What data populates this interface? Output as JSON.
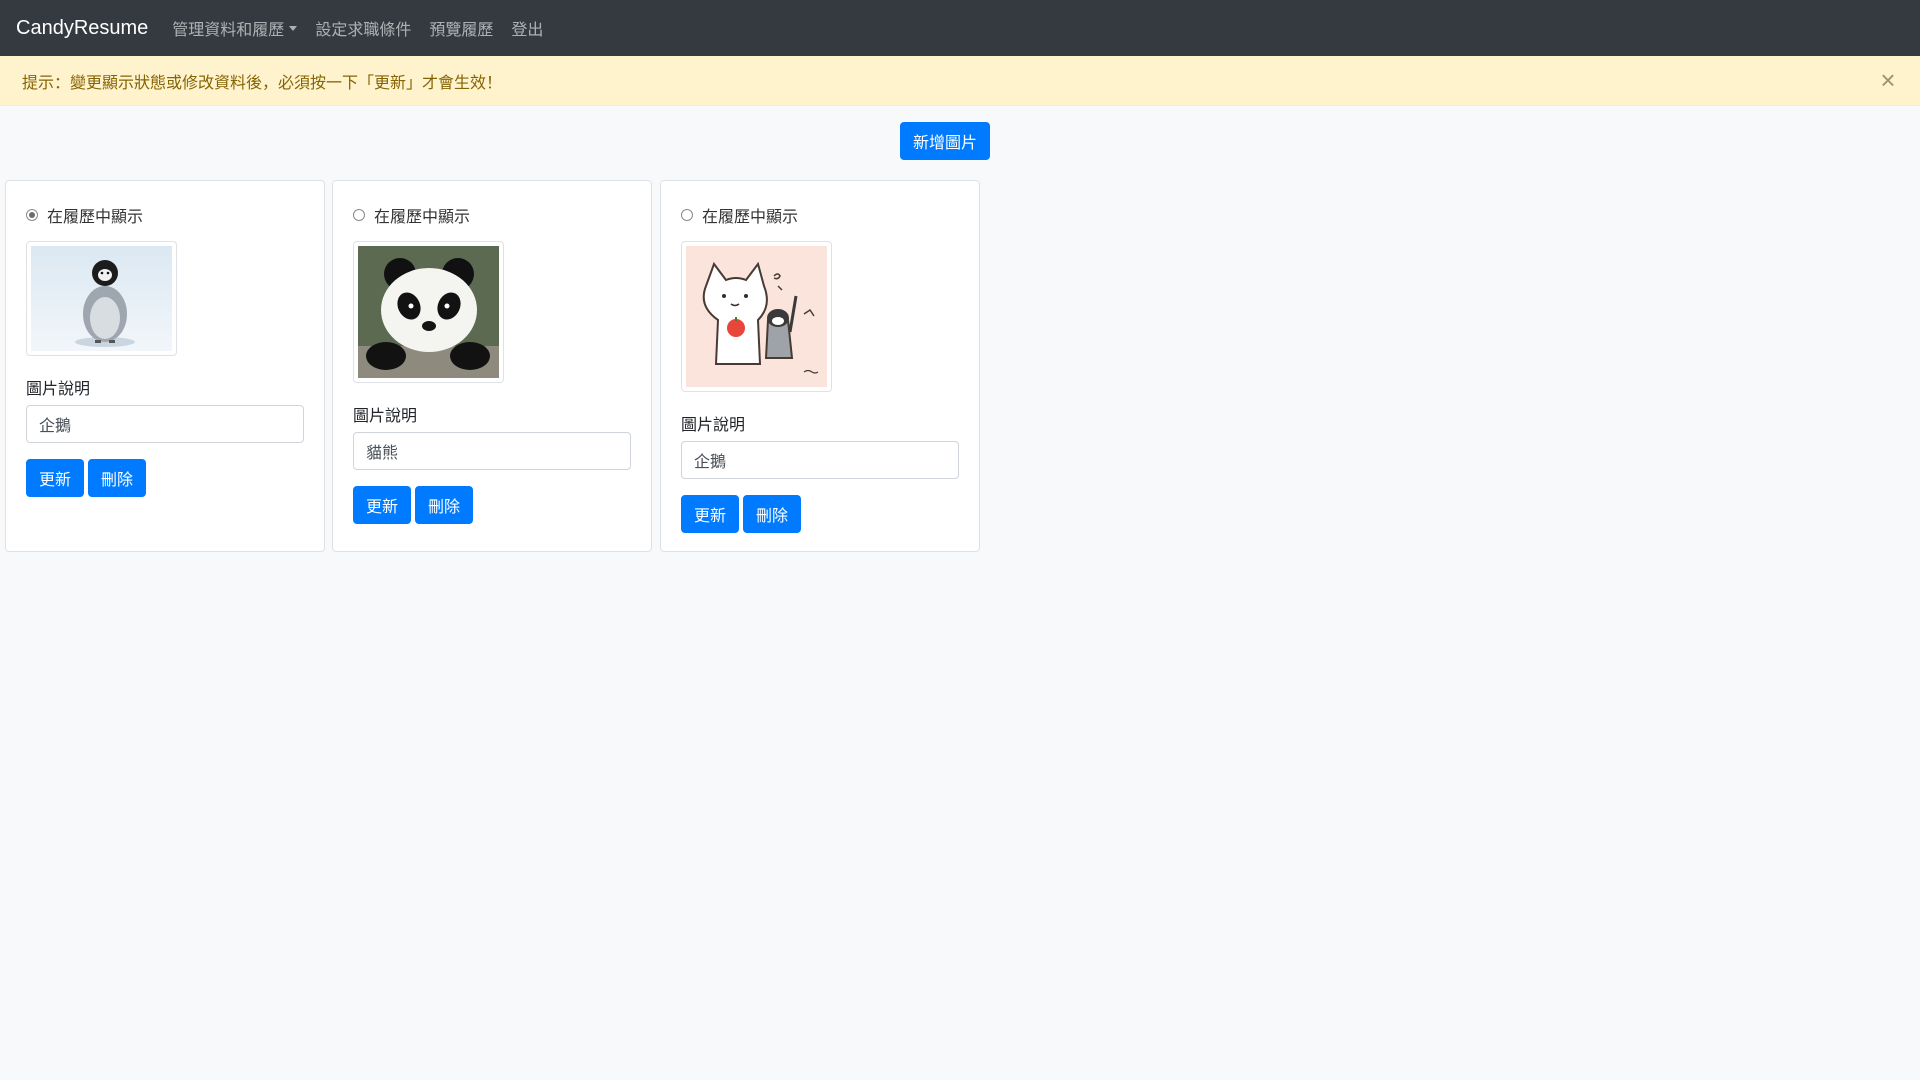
{
  "navbar": {
    "brand": "CandyResume",
    "items": [
      {
        "label": "管理資料和履歷",
        "dropdown": true
      },
      {
        "label": "設定求職條件"
      },
      {
        "label": "預覽履歷"
      },
      {
        "label": "登出"
      }
    ]
  },
  "alert": {
    "message": "提示：變更顯示狀態或修改資料後，必須按一下「更新」才會生效！",
    "close_label": "×"
  },
  "add_button_label": "新增圖片",
  "cards": [
    {
      "show_label": "在履歷中顯示",
      "selected": true,
      "image": "penguin-chick-photo",
      "caption_label": "圖片說明",
      "caption_value": "企鵝",
      "update_label": "更新",
      "delete_label": "刪除"
    },
    {
      "show_label": "在履歷中顯示",
      "selected": false,
      "image": "panda-photo",
      "caption_label": "圖片說明",
      "caption_value": "貓熊",
      "update_label": "更新",
      "delete_label": "刪除"
    },
    {
      "show_label": "在履歷中顯示",
      "selected": false,
      "image": "cat-and-penguin-illustration",
      "caption_label": "圖片說明",
      "caption_value": "企鵝",
      "update_label": "更新",
      "delete_label": "刪除"
    }
  ],
  "colors": {
    "navbar": "#343a40",
    "alert_bg": "#fff3cd",
    "alert_text": "#856404",
    "primary": "#007bff"
  }
}
